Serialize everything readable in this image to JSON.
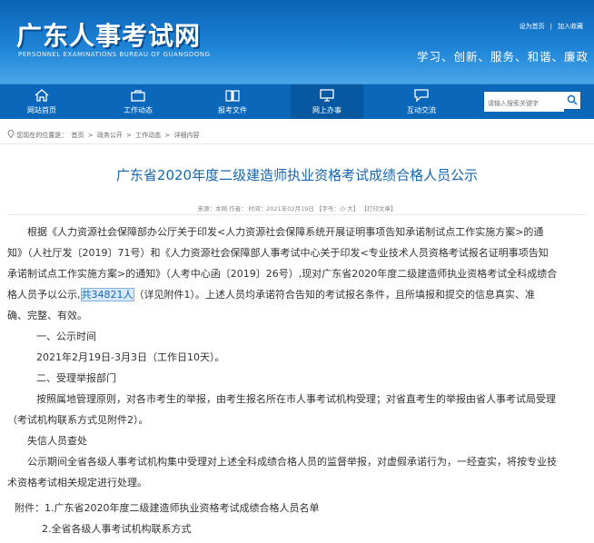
{
  "header": {
    "site_title": "广东人事考试网",
    "site_subtitle": "PERSONNEL EXAMINATIONS BUREAU OF GUANGDONG",
    "top_links": [
      "设为首页",
      "加入收藏"
    ],
    "slogan": "学习、创新、服务、和谐、廉政"
  },
  "nav": {
    "items": [
      {
        "label": "网站首页",
        "icon": "home-icon"
      },
      {
        "label": "工作动态",
        "icon": "briefcase-icon"
      },
      {
        "label": "报考文件",
        "icon": "book-icon"
      },
      {
        "label": "网上办事",
        "icon": "monitor-icon"
      },
      {
        "label": "互动交流",
        "icon": "chat-icon"
      }
    ],
    "search_placeholder": "请输入搜索关键字"
  },
  "breadcrumb": {
    "prefix": "您现在的位置是：",
    "items": [
      "首页",
      "政务公开",
      "工作动态",
      "详细内容"
    ],
    "separator": ">"
  },
  "article": {
    "title": "广东省2020年度二级建造师执业资格考试成绩合格人员公示",
    "meta": "来源：本网   作者：   时间：2021年02月19日   【字号：小 大】  【打印文章】",
    "lines": [
      "根据《人力资源社会保障部办公厅关于印发<人力资源社会保障系统开展证明事项告知承诺制试点工作实施方案>的通",
      "知》（人社厅发〔2019〕71号）和《人力资源社会保障部人事考试中心关于印发<专业技术人员资格考试报名证明事项告知",
      "承诺制试点工作实施方案>的通知》（人考中心函〔2019〕26号）,现对广东省2020年度二级建造师执业资格考试全科成绩合",
      "格人员予以公示,",
      "共34821人",
      "（详见附件1）。上述人员均承诺符合告知的考试报名条件，且所填报和提交的信息真实、准",
      "确、完整、有效。",
      "一、公示时间",
      "2021年2月19日-3月3日（工作日10天）。",
      "二、受理举报部门",
      "按照属地管理原则，对各市考生的举报，由考生报名所在市人事考试机构受理；对省直考生的举报由省人事考试局受理",
      "（考试机构联系方式见附件2）。",
      "失信人员查处",
      "公示期间全省各级人事考试机构集中受理对上述全科成绩合格人员的监督举报，对虚假承诺行为，一经查实，将按专业技",
      "术资格考试相关规定进行处理。",
      "附件：1.广东省2020年度二级建造师执业资格考试成绩合格人员名单",
      "2.全省各级人事考试机构联系方式"
    ]
  },
  "colors": {
    "header_blue": "#0b67b9",
    "title_blue": "#1a67ad",
    "highlight_bg": "#d7e9fb"
  }
}
